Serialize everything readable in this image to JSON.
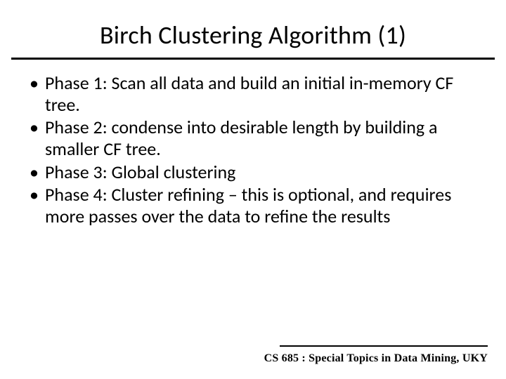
{
  "title": "Birch Clustering Algorithm (1)",
  "bullets": [
    "Phase 1: Scan all data and build an initial in-memory CF tree.",
    "Phase 2: condense into desirable length by building a smaller CF tree.",
    "Phase 3: Global clustering",
    "Phase 4: Cluster refining – this is optional, and requires more passes over the data to refine the results"
  ],
  "footer": "CS 685 : Special Topics in Data Mining, UKY"
}
